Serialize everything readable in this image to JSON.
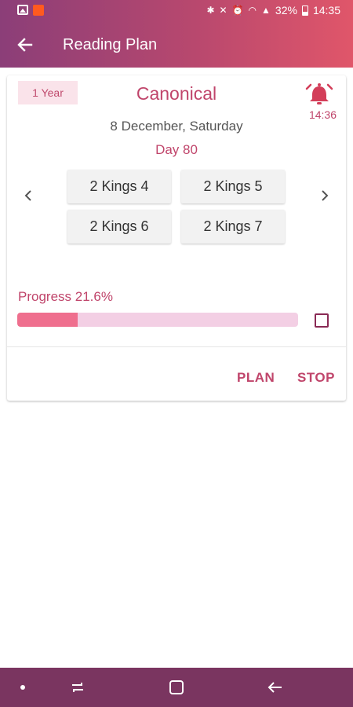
{
  "status_bar": {
    "battery": "32%",
    "time": "14:35"
  },
  "app_bar": {
    "title": "Reading Plan"
  },
  "card": {
    "badge": "1 Year",
    "plan_name": "Canonical",
    "alarm_time": "14:36",
    "date": "8 December, Saturday",
    "day": "Day 80",
    "chapters": [
      "2 Kings 4",
      "2 Kings 5",
      "2 Kings 6",
      "2 Kings 7"
    ],
    "progress_label": "Progress 21.6%",
    "progress_fraction": 0.216,
    "completed_checked": false,
    "actions": {
      "plan": "PLAN",
      "stop": "STOP"
    }
  },
  "colors": {
    "accent": "#c0456b",
    "progress_fill": "#ef6f8e",
    "progress_track": "#f3cfe4",
    "navbar": "#7a3560"
  }
}
